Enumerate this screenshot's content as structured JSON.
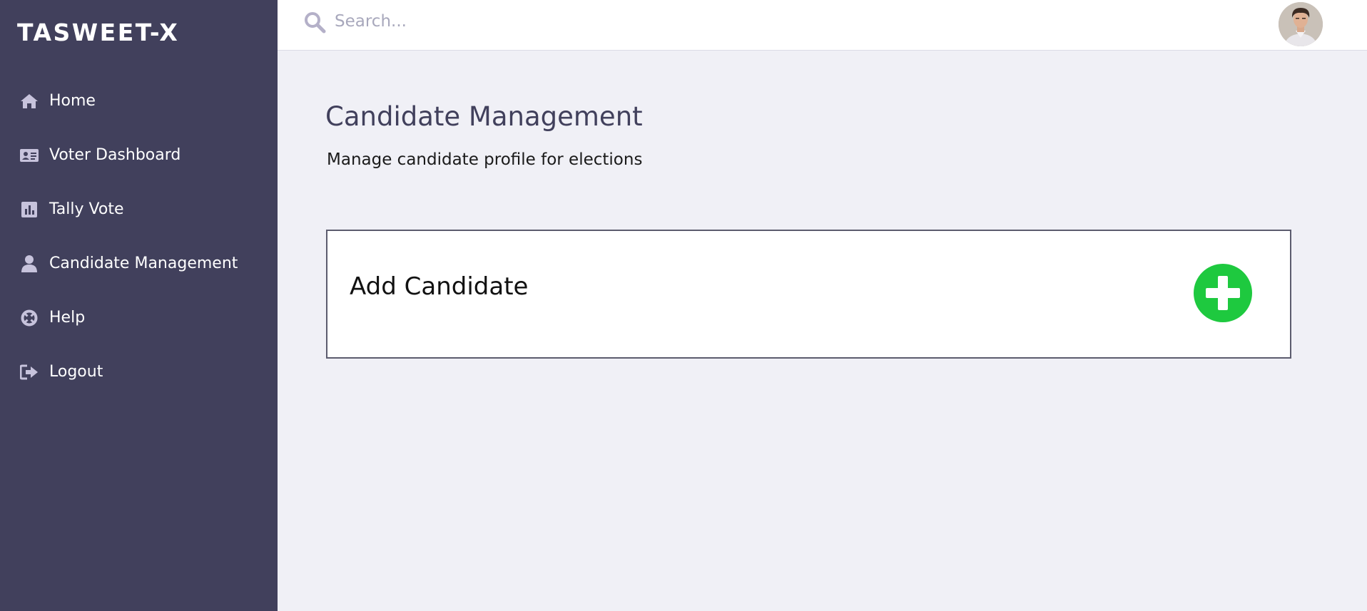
{
  "app": {
    "brand": "TASWEET-X"
  },
  "sidebar": {
    "items": [
      {
        "label": "Home",
        "icon": "home-icon"
      },
      {
        "label": "Voter Dashboard",
        "icon": "id-card-icon"
      },
      {
        "label": "Tally Vote",
        "icon": "bar-chart-icon"
      },
      {
        "label": "Candidate Management",
        "icon": "user-icon"
      },
      {
        "label": "Help",
        "icon": "lifebuoy-icon"
      },
      {
        "label": "Logout",
        "icon": "sign-out-icon"
      }
    ]
  },
  "header": {
    "search": {
      "placeholder": "Search...",
      "value": ""
    },
    "avatar": "user-avatar"
  },
  "main": {
    "title": "Candidate Management",
    "subtitle": "Manage candidate profile for elections",
    "card": {
      "title": "Add Candidate",
      "action_icon": "plus-circle-icon"
    }
  },
  "colors": {
    "sidebar_bg": "#41405c",
    "page_bg": "#f0f0f6",
    "icon_tint": "#c7c3dc",
    "add_button": "#1ec93f",
    "title_text": "#41405c"
  }
}
